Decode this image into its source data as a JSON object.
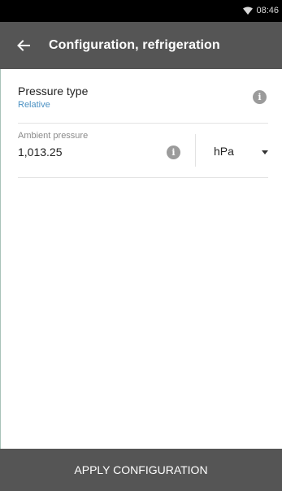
{
  "status_bar": {
    "time": "08:46",
    "wifi_icon": "wifi-icon"
  },
  "app_bar": {
    "back_icon": "back-arrow-icon",
    "title": "Configuration, refrigeration"
  },
  "pressure_type": {
    "label": "Pressure type",
    "value": "Relative",
    "info_icon": "info-icon",
    "info_glyph": "i"
  },
  "ambient_pressure": {
    "label": "Ambient pressure",
    "value": "1,013.25",
    "info_icon": "info-icon",
    "info_glyph": "i",
    "unit": "hPa",
    "unit_dropdown_icon": "dropdown-icon"
  },
  "footer": {
    "apply_label": "APPLY CONFIGURATION"
  },
  "colors": {
    "app_bar_bg": "#555555",
    "status_bar_bg": "#000000",
    "link_blue": "#4a90c2",
    "info_icon_gray": "#9b9b9b"
  }
}
